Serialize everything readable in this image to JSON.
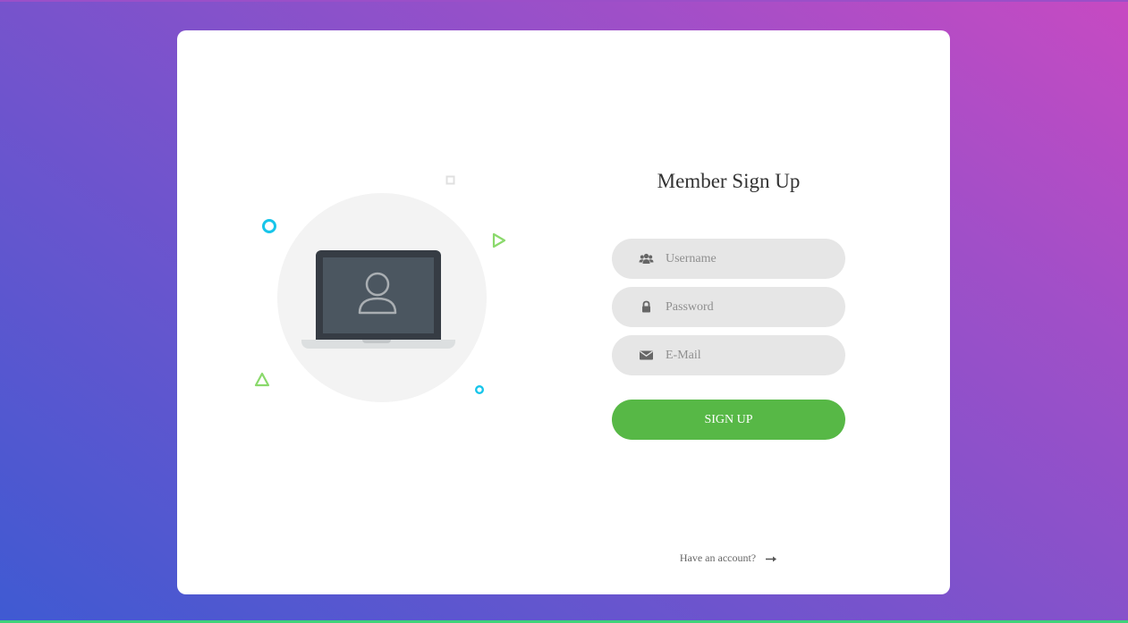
{
  "colors": {
    "accent_green": "#57b846",
    "input_background": "#e6e6e6",
    "decor_cyan": "#17c5ea",
    "decor_green": "#8ad96b",
    "laptop_dark": "#363c44"
  },
  "illustration": {
    "icon": "laptop-user-icon"
  },
  "form": {
    "title": "Member Sign Up",
    "fields": [
      {
        "icon": "users-icon",
        "placeholder": "Username",
        "value": ""
      },
      {
        "icon": "lock-icon",
        "placeholder": "Password",
        "value": ""
      },
      {
        "icon": "envelope-icon",
        "placeholder": "E-Mail",
        "value": ""
      }
    ],
    "submit_label": "SIGN UP"
  },
  "footer": {
    "account_link_label": "Have an account?",
    "account_link_icon": "arrow-right-icon"
  }
}
